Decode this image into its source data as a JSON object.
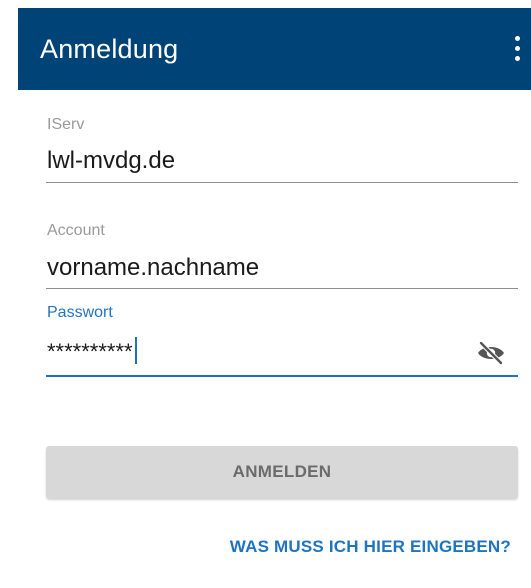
{
  "appbar": {
    "title": "Anmeldung",
    "menu_icon": "more-vert-icon",
    "background_color": "#004377"
  },
  "form": {
    "iserv": {
      "label": "IServ",
      "value": "lwl-mvdg.de"
    },
    "account": {
      "label": "Account",
      "value": "vorname.nachname"
    },
    "password": {
      "label": "Passwort",
      "value": "**********",
      "toggle_icon": "visibility-off-icon",
      "focused": true,
      "accent_color": "#1f74c1"
    }
  },
  "actions": {
    "login_label": "ANMELDEN",
    "help_label": "WAS MUSS ICH HIER EINGEBEN?"
  }
}
